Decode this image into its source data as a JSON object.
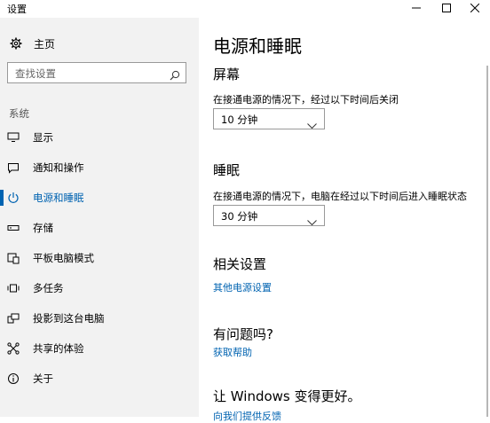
{
  "window": {
    "title": "设置"
  },
  "sidebar": {
    "home_label": "主页",
    "search_placeholder": "查找设置",
    "section_label": "系统",
    "items": [
      {
        "label": "显示",
        "icon": "monitor-icon"
      },
      {
        "label": "通知和操作",
        "icon": "notification-icon"
      },
      {
        "label": "电源和睡眠",
        "icon": "power-icon",
        "active": true
      },
      {
        "label": "存储",
        "icon": "storage-icon"
      },
      {
        "label": "平板电脑模式",
        "icon": "tablet-mode-icon"
      },
      {
        "label": "多任务",
        "icon": "multitasking-icon"
      },
      {
        "label": "投影到这台电脑",
        "icon": "project-icon"
      },
      {
        "label": "共享的体验",
        "icon": "shared-experiences-icon"
      },
      {
        "label": "关于",
        "icon": "info-icon"
      }
    ]
  },
  "main": {
    "title": "电源和睡眠",
    "screen": {
      "heading": "屏幕",
      "description": "在接通电源的情况下，经过以下时间后关闭",
      "value": "10 分钟"
    },
    "sleep": {
      "heading": "睡眠",
      "description": "在接通电源的情况下，电脑在经过以下时间后进入睡眠状态",
      "value": "30 分钟"
    },
    "related": {
      "heading": "相关设置",
      "link": "其他电源设置"
    },
    "questions": {
      "heading": "有问题吗?",
      "link": "获取帮助"
    },
    "feedback": {
      "heading": "让 Windows 变得更好。",
      "link": "向我们提供反馈"
    }
  },
  "colors": {
    "accent": "#0063b1",
    "sidebar_bg": "#f2f2f2"
  }
}
